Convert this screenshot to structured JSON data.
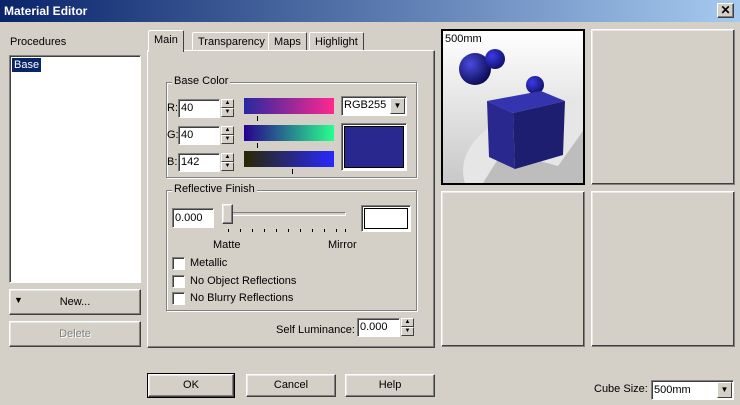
{
  "window": {
    "title": "Material Editor",
    "close_glyph": "✕"
  },
  "procedures": {
    "label": "Procedures",
    "items": [
      "Base"
    ],
    "new_label": "New...",
    "delete_label": "Delete"
  },
  "tabs": [
    "Main",
    "Transparency",
    "Maps",
    "Highlight"
  ],
  "base_color": {
    "group_label": "Base Color",
    "r_label": "R:",
    "g_label": "G:",
    "b_label": "B:",
    "r": "40",
    "g": "40",
    "b": "142",
    "mode": "RGB255",
    "swatch_color": "#28288e"
  },
  "reflective": {
    "group_label": "Reflective Finish",
    "value": "0.000",
    "matte_label": "Matte",
    "mirror_label": "Mirror",
    "slider_level": 0.0,
    "checkboxes": [
      {
        "label": "Metallic",
        "checked": false
      },
      {
        "label": "No Object Reflections",
        "checked": false
      },
      {
        "label": "No Blurry Reflections",
        "checked": false
      }
    ]
  },
  "self_luminance": {
    "label": "Self Luminance:",
    "value": "0.000"
  },
  "preview": {
    "size_label": "500mm"
  },
  "footer": {
    "ok": "OK",
    "cancel": "Cancel",
    "help": "Help",
    "cube_size_label": "Cube Size:",
    "cube_size_value": "500mm"
  },
  "colors": {
    "accent": "#0a246a",
    "object_blue": "#28288e"
  }
}
